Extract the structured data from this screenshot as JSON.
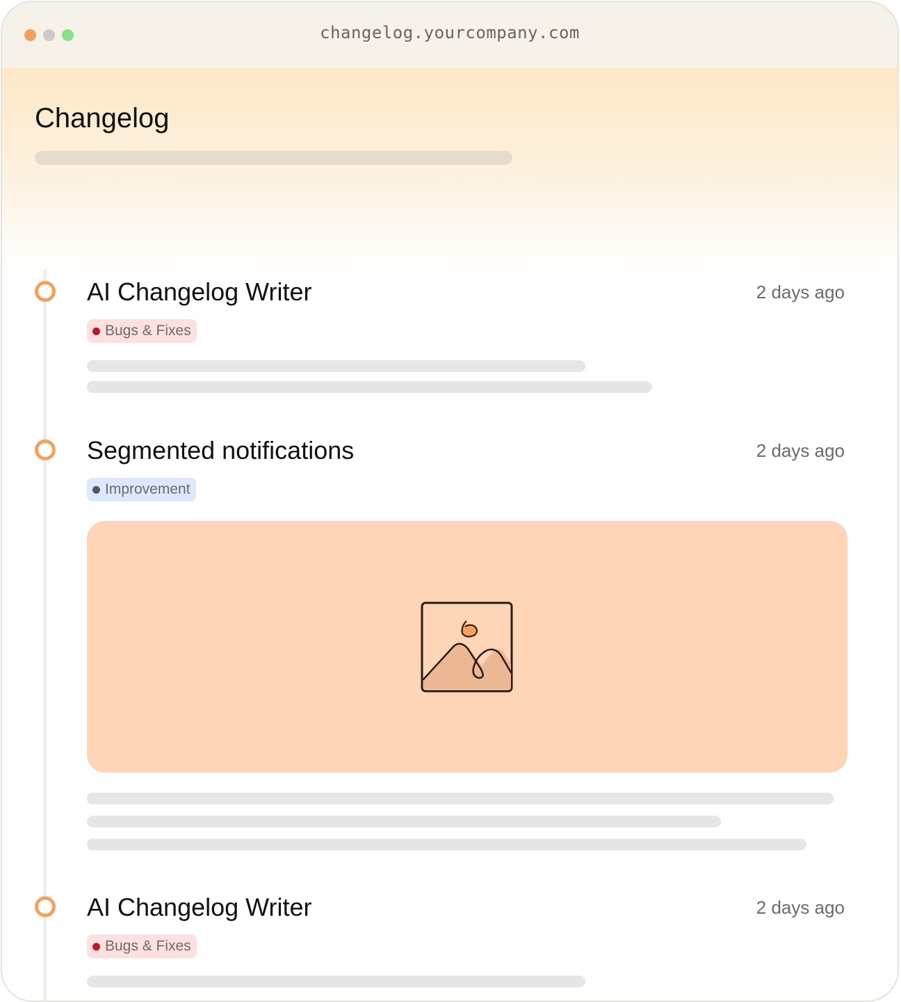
{
  "window": {
    "url": "changelog.yourcompany.com",
    "traffic_lights": [
      "close",
      "minimize",
      "maximize"
    ]
  },
  "colors": {
    "accent": "#f5a05c",
    "bug_tag_bg": "#fde0df",
    "bug_dot": "#c0182a",
    "improvement_tag_bg": "#dce8fc",
    "image_placeholder_bg": "#fed5b7"
  },
  "page": {
    "title": "Changelog"
  },
  "entries": [
    {
      "title": "AI Changelog Writer",
      "date": "2 days ago",
      "tag": "Bugs & Fixes",
      "has_image": false
    },
    {
      "title": "Segmented notifications",
      "date": "2 days ago",
      "tag": "Improvement",
      "has_image": true,
      "image_icon": "image-placeholder-icon"
    },
    {
      "title": "AI Changelog Writer",
      "date": "2 days ago",
      "tag": "Bugs & Fixes",
      "has_image": false
    }
  ]
}
